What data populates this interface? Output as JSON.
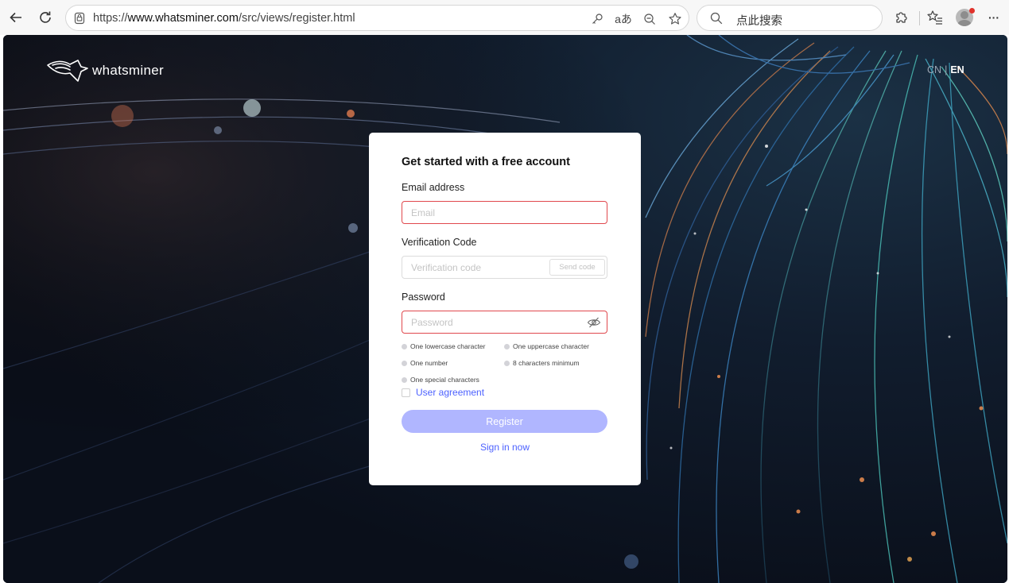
{
  "browser": {
    "url_prefix": "https://",
    "url_host": "www.whatsminer.com",
    "url_path": "/src/views/register.html",
    "search_placeholder": "点此搜索",
    "icons": [
      "back-arrow-icon",
      "refresh-icon",
      "lock-icon",
      "key-icon",
      "read-aloud-icon",
      "zoom-out-icon",
      "star-icon",
      "search-icon",
      "extensions-icon",
      "favorites-icon",
      "profile-avatar",
      "more-icon"
    ],
    "translate_glyph": "aあ",
    "more_glyph": "···"
  },
  "header": {
    "brand_name": "whatsminer",
    "lang_cn": "CN",
    "lang_separator": "|",
    "lang_en": "EN"
  },
  "form": {
    "title": "Get started with a free account",
    "email_label": "Email address",
    "email_placeholder": "Email",
    "code_label": "Verification Code",
    "code_placeholder": "Verification code",
    "send_code": "Send code",
    "password_label": "Password",
    "password_placeholder": "Password",
    "rules": [
      "One lowercase character",
      "One uppercase character",
      "One number",
      "8 characters minimum",
      "One special characters"
    ],
    "agreement": "User agreement",
    "register": "Register",
    "sign_in": "Sign in now"
  },
  "colors": {
    "accent": "#4d62ff",
    "button_disabled": "#b0b6ff",
    "error_border": "#e0484d",
    "background": "#0c1220"
  }
}
